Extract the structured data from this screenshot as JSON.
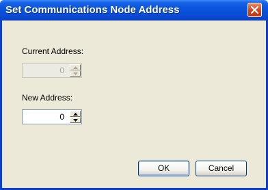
{
  "window": {
    "title": "Set Communications Node Address"
  },
  "icons": {
    "close": "close-icon",
    "spin_up": "arrow-up-icon",
    "spin_down": "arrow-down-icon"
  },
  "current_address": {
    "label": "Current Address:",
    "value": "0",
    "enabled": false
  },
  "new_address": {
    "label": "New Address:",
    "value": "0",
    "enabled": true
  },
  "buttons": {
    "ok": "OK",
    "cancel": "Cancel"
  },
  "colors": {
    "titlebar": "#0a4cd6",
    "client": "#ece9d8",
    "close": "#d3431c"
  }
}
